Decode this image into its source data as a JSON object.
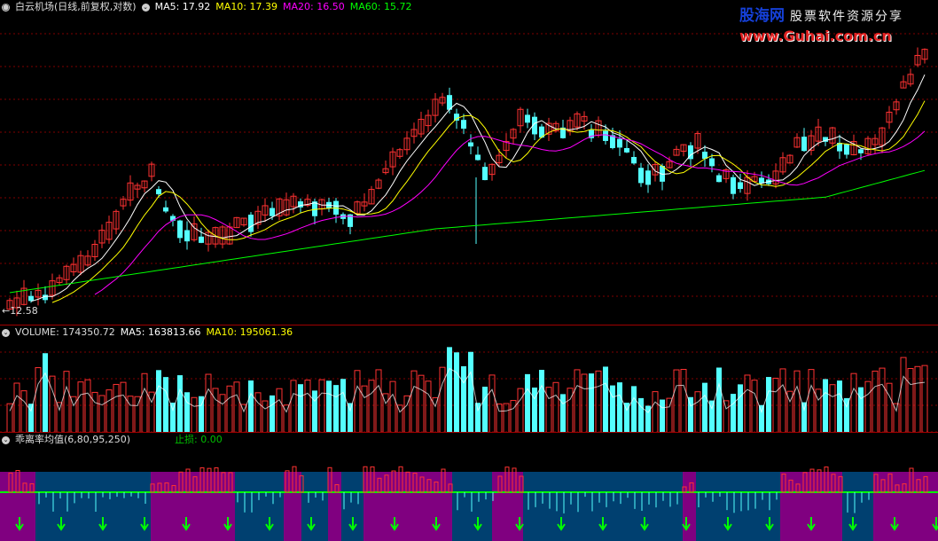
{
  "price": {
    "title": "白云机场(日线,前复权,对数)",
    "ma_labels": [
      {
        "text": "MA5: 17.92",
        "color": "#ffffff"
      },
      {
        "text": "MA10: 17.39",
        "color": "#ffff00"
      },
      {
        "text": "MA20: 16.50",
        "color": "#ff00ff"
      },
      {
        "text": "MA60: 15.72",
        "color": "#00ff00"
      }
    ],
    "low_label": "←12.58"
  },
  "volume": {
    "title": "VOLUME: 174350.72",
    "ma_labels": [
      {
        "text": "MA5: 163813.66",
        "color": "#ffffff"
      },
      {
        "text": "MA10: 195061.36",
        "color": "#ffff00"
      }
    ]
  },
  "indicator": {
    "title": "乖离率均值(6,80,95,250)",
    "stop_label": "止损: 0.00",
    "stop_color": "#00c000"
  },
  "logo": {
    "line1": "股海网",
    "line1b": "股票软件资源分享",
    "line2": "www.Guhai.com.cn"
  },
  "colors": {
    "up": "#ff3232",
    "down": "#54ffff",
    "grid": "#800000",
    "ma5": "#ffffff",
    "ma10": "#ffff00",
    "ma20": "#ff00ff",
    "ma60": "#00ff00",
    "zone_purple": "#800080",
    "zone_blue": "#004070",
    "arrow": "#00ff00"
  },
  "icons": [
    "collapse-circle-icon",
    "down-arrow-icon"
  ]
}
